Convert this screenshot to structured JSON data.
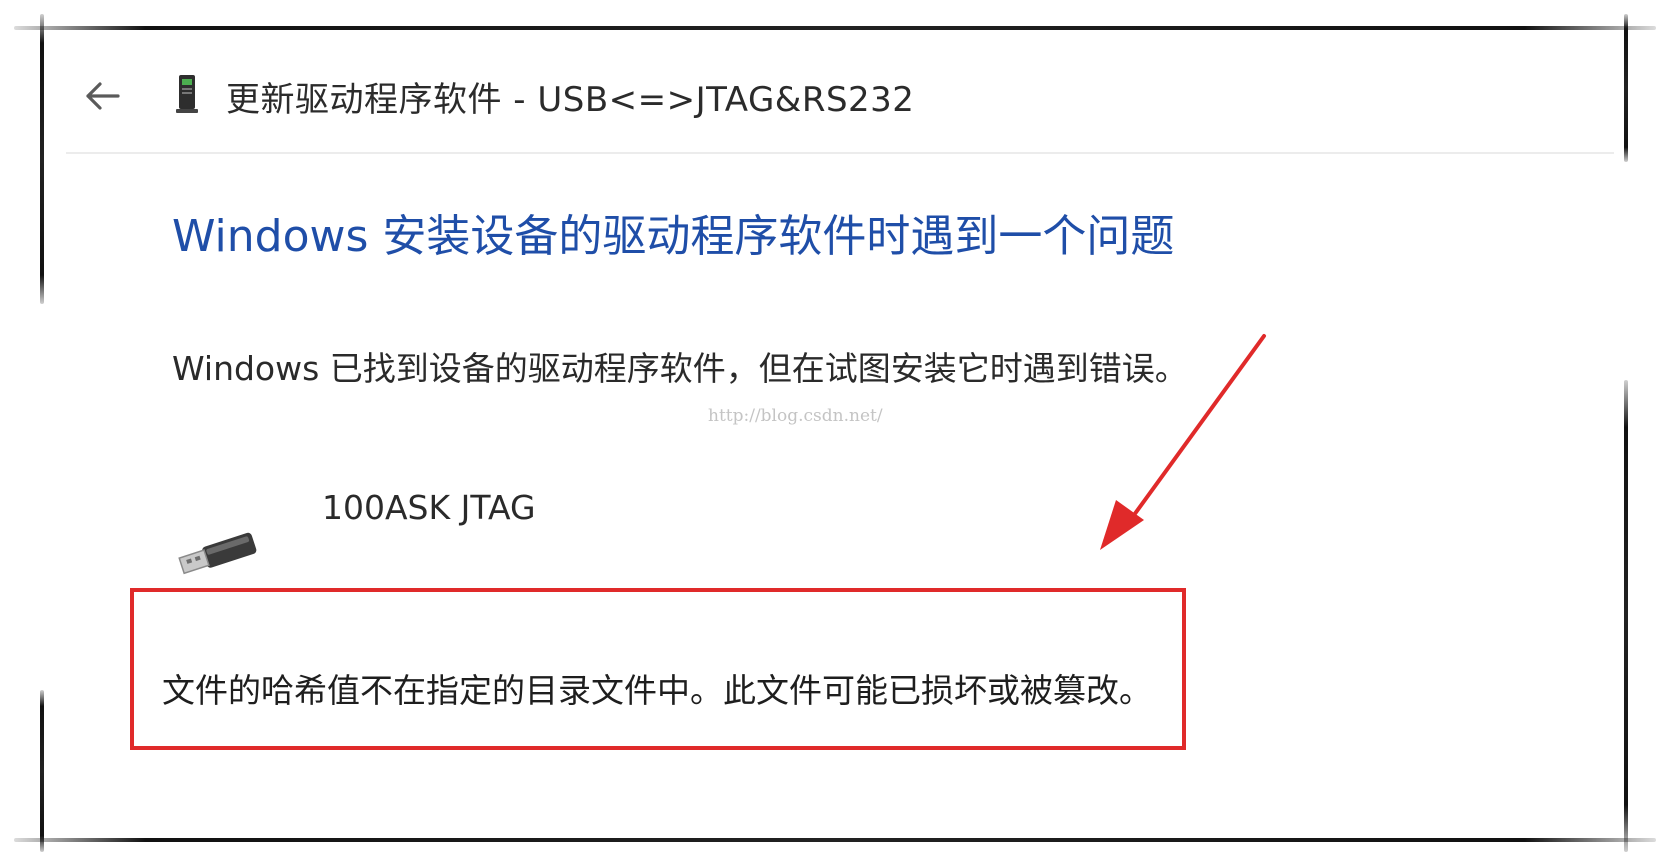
{
  "window": {
    "title": "更新驱动程序软件 - USB<=>JTAG&RS232"
  },
  "content": {
    "heading": "Windows 安装设备的驱动程序软件时遇到一个问题",
    "description": "Windows 已找到设备的驱动程序软件，但在试图安装它时遇到错误。",
    "device_name": "100ASK JTAG",
    "error_message": "文件的哈希值不在指定的目录文件中。此文件可能已损坏或被篡改。"
  },
  "watermark": "http://blog.csdn.net/",
  "icons": {
    "back": "back-arrow-icon",
    "device": "device-manager-icon",
    "usb": "usb-connector-icon"
  },
  "colors": {
    "heading": "#1f4ea8",
    "highlight_box": "#e02a2a",
    "annotation_arrow": "#e02a2a"
  }
}
